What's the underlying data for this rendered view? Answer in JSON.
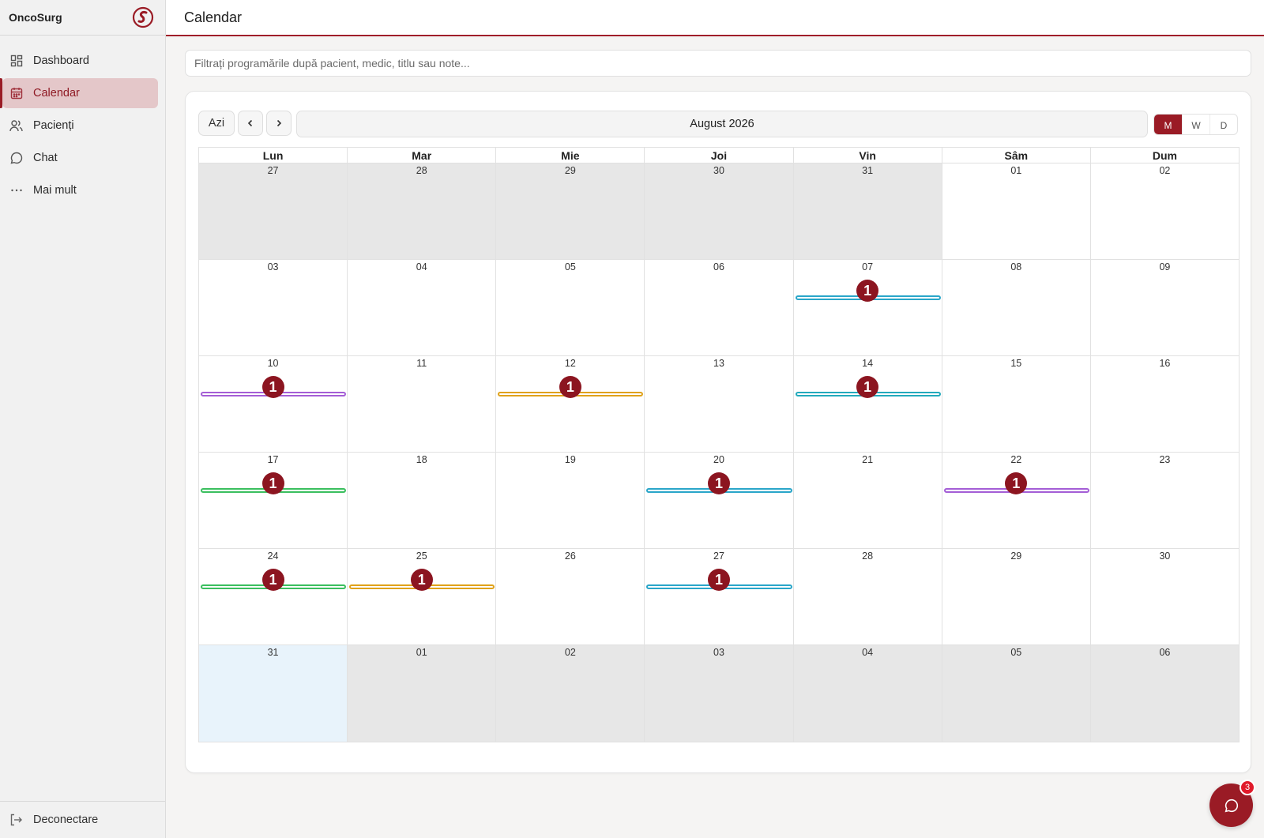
{
  "app": {
    "name": "OncoSurg"
  },
  "sidebar": {
    "items": [
      {
        "label": "Dashboard",
        "icon": "dashboard-icon"
      },
      {
        "label": "Calendar",
        "icon": "calendar-icon",
        "active": true
      },
      {
        "label": "Pacienți",
        "icon": "patients-icon"
      },
      {
        "label": "Chat",
        "icon": "chat-icon"
      },
      {
        "label": "Mai mult",
        "icon": "more-icon"
      }
    ],
    "logout": "Deconectare"
  },
  "header": {
    "title": "Calendar"
  },
  "filter": {
    "placeholder": "Filtrați programările după pacient, medic, titlu sau note...",
    "value": ""
  },
  "toolbar": {
    "today": "Azi",
    "month_label": "August 2026",
    "views": [
      "M",
      "W",
      "D"
    ],
    "active_view": "M"
  },
  "calendar": {
    "weekdays": [
      "Lun",
      "Mar",
      "Mie",
      "Joi",
      "Vin",
      "Sâm",
      "Dum"
    ],
    "weeks": [
      [
        {
          "d": "27",
          "other": true
        },
        {
          "d": "28",
          "other": true
        },
        {
          "d": "29",
          "other": true
        },
        {
          "d": "30",
          "other": true
        },
        {
          "d": "31",
          "other": true
        },
        {
          "d": "01"
        },
        {
          "d": "02"
        }
      ],
      [
        {
          "d": "03"
        },
        {
          "d": "04"
        },
        {
          "d": "05"
        },
        {
          "d": "06"
        },
        {
          "d": "07",
          "count": "1",
          "color": "#2aa6c9"
        },
        {
          "d": "08"
        },
        {
          "d": "09"
        }
      ],
      [
        {
          "d": "10",
          "count": "1",
          "color": "#a45ed6"
        },
        {
          "d": "11"
        },
        {
          "d": "12",
          "count": "1",
          "color": "#e0a21a"
        },
        {
          "d": "13"
        },
        {
          "d": "14",
          "count": "1",
          "color": "#23aabc"
        },
        {
          "d": "15"
        },
        {
          "d": "16"
        }
      ],
      [
        {
          "d": "17",
          "count": "1",
          "color": "#3bbf5f"
        },
        {
          "d": "18"
        },
        {
          "d": "19"
        },
        {
          "d": "20",
          "count": "1",
          "color": "#2aa6c9"
        },
        {
          "d": "21"
        },
        {
          "d": "22",
          "count": "1",
          "color": "#a45ed6"
        },
        {
          "d": "23"
        }
      ],
      [
        {
          "d": "24",
          "count": "1",
          "color": "#3bbf5f"
        },
        {
          "d": "25",
          "count": "1",
          "color": "#e0a21a"
        },
        {
          "d": "26"
        },
        {
          "d": "27",
          "count": "1",
          "color": "#2aa6c9"
        },
        {
          "d": "28"
        },
        {
          "d": "29"
        },
        {
          "d": "30"
        }
      ],
      [
        {
          "d": "31",
          "today": true
        },
        {
          "d": "01",
          "other": true
        },
        {
          "d": "02",
          "other": true
        },
        {
          "d": "03",
          "other": true
        },
        {
          "d": "04",
          "other": true
        },
        {
          "d": "05",
          "other": true
        },
        {
          "d": "06",
          "other": true
        }
      ]
    ]
  },
  "chat_fab": {
    "unread": "3"
  },
  "colors": {
    "brand": "#9a1b25",
    "badge": "#8c1520",
    "today_bg": "#e8f3fb",
    "other_month_bg": "#e7e7e7"
  }
}
